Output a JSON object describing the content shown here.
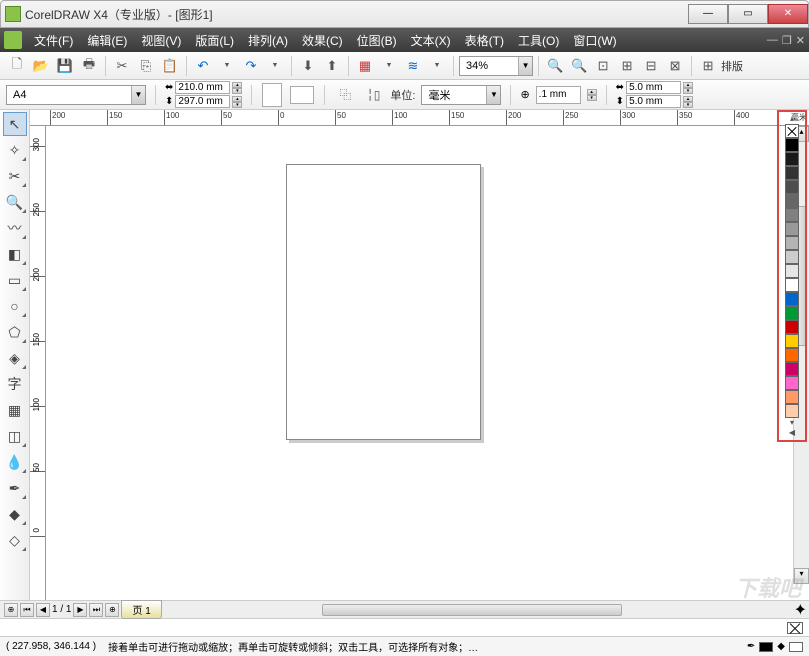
{
  "title": "CorelDRAW X4（专业版）- [图形1]",
  "menu": [
    "文件(F)",
    "编辑(E)",
    "视图(V)",
    "版面(L)",
    "排列(A)",
    "效果(C)",
    "位图(B)",
    "文本(X)",
    "表格(T)",
    "工具(O)",
    "窗口(W)"
  ],
  "zoom": "34%",
  "排版": "排版",
  "paper": "A4",
  "width": "210.0 mm",
  "height": "297.0 mm",
  "units_label": "单位:",
  "units_value": "毫米",
  "nudge": ".1 mm",
  "dup_x": "5.0 mm",
  "dup_y": "5.0 mm",
  "ruler_h": [
    "200",
    "150",
    "100",
    "50",
    "0",
    "50",
    "100",
    "150",
    "200",
    "250",
    "300",
    "350",
    "400"
  ],
  "ruler_v": [
    "300",
    "250",
    "200",
    "150",
    "100",
    "50",
    "0"
  ],
  "ruler_unit": "毫米",
  "page_count": "1 / 1",
  "page_tab": "页 1",
  "coords": "( 227.958, 346.144 )",
  "hint": "接着单击可进行拖动或缩放；再单击可旋转或倾斜；双击工具，可选择所有对象；…",
  "colors": [
    "#000000",
    "#1a1a1a",
    "#333333",
    "#4d4d4d",
    "#666666",
    "#808080",
    "#999999",
    "#b3b3b3",
    "#cccccc",
    "#e6e6e6",
    "#ffffff",
    "#0066cc",
    "#009933",
    "#cc0000",
    "#ffcc00",
    "#ff6600",
    "#cc0066",
    "#ff66cc",
    "#ff9966",
    "#ffccaa"
  ],
  "watermark": "下载吧"
}
